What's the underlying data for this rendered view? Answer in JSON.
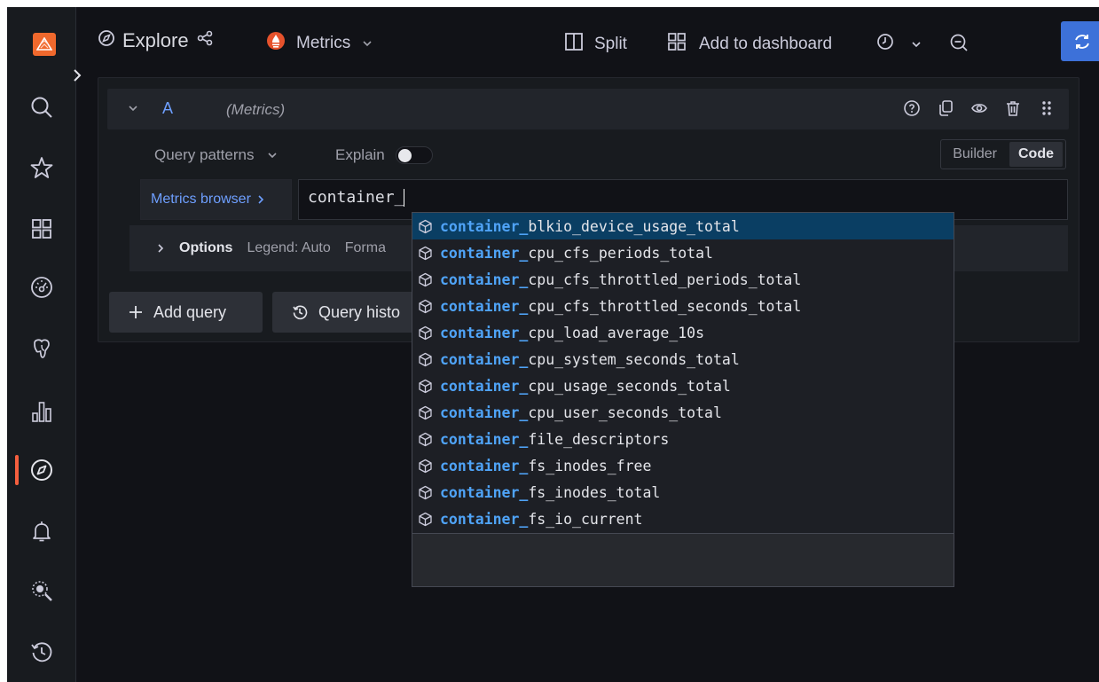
{
  "topbar": {
    "title": "Explore",
    "datasource": "Metrics",
    "split_label": "Split",
    "add_to_dashboard_label": "Add to dashboard"
  },
  "query": {
    "ref_id": "A",
    "datasource": "(Metrics)",
    "query_patterns_label": "Query patterns",
    "explain_label": "Explain",
    "builder_label": "Builder",
    "code_label": "Code",
    "metrics_browser_label": "Metrics browser",
    "input_value": "container_",
    "options_label": "Options",
    "legend_label": "Legend: Auto",
    "format_label": "Forma"
  },
  "actions": {
    "add_query_label": "Add query",
    "query_history_label": "Query histo"
  },
  "suggestions": {
    "prefix": "container_",
    "items": [
      "blkio_device_usage_total",
      "cpu_cfs_periods_total",
      "cpu_cfs_throttled_periods_total",
      "cpu_cfs_throttled_seconds_total",
      "cpu_load_average_10s",
      "cpu_system_seconds_total",
      "cpu_usage_seconds_total",
      "cpu_user_seconds_total",
      "file_descriptors",
      "fs_inodes_free",
      "fs_inodes_total",
      "fs_io_current"
    ],
    "selected_index": 0
  },
  "colors": {
    "accent": "#3d71d9",
    "brand": "#f55f3e",
    "highlight": "#4fa3f7"
  }
}
